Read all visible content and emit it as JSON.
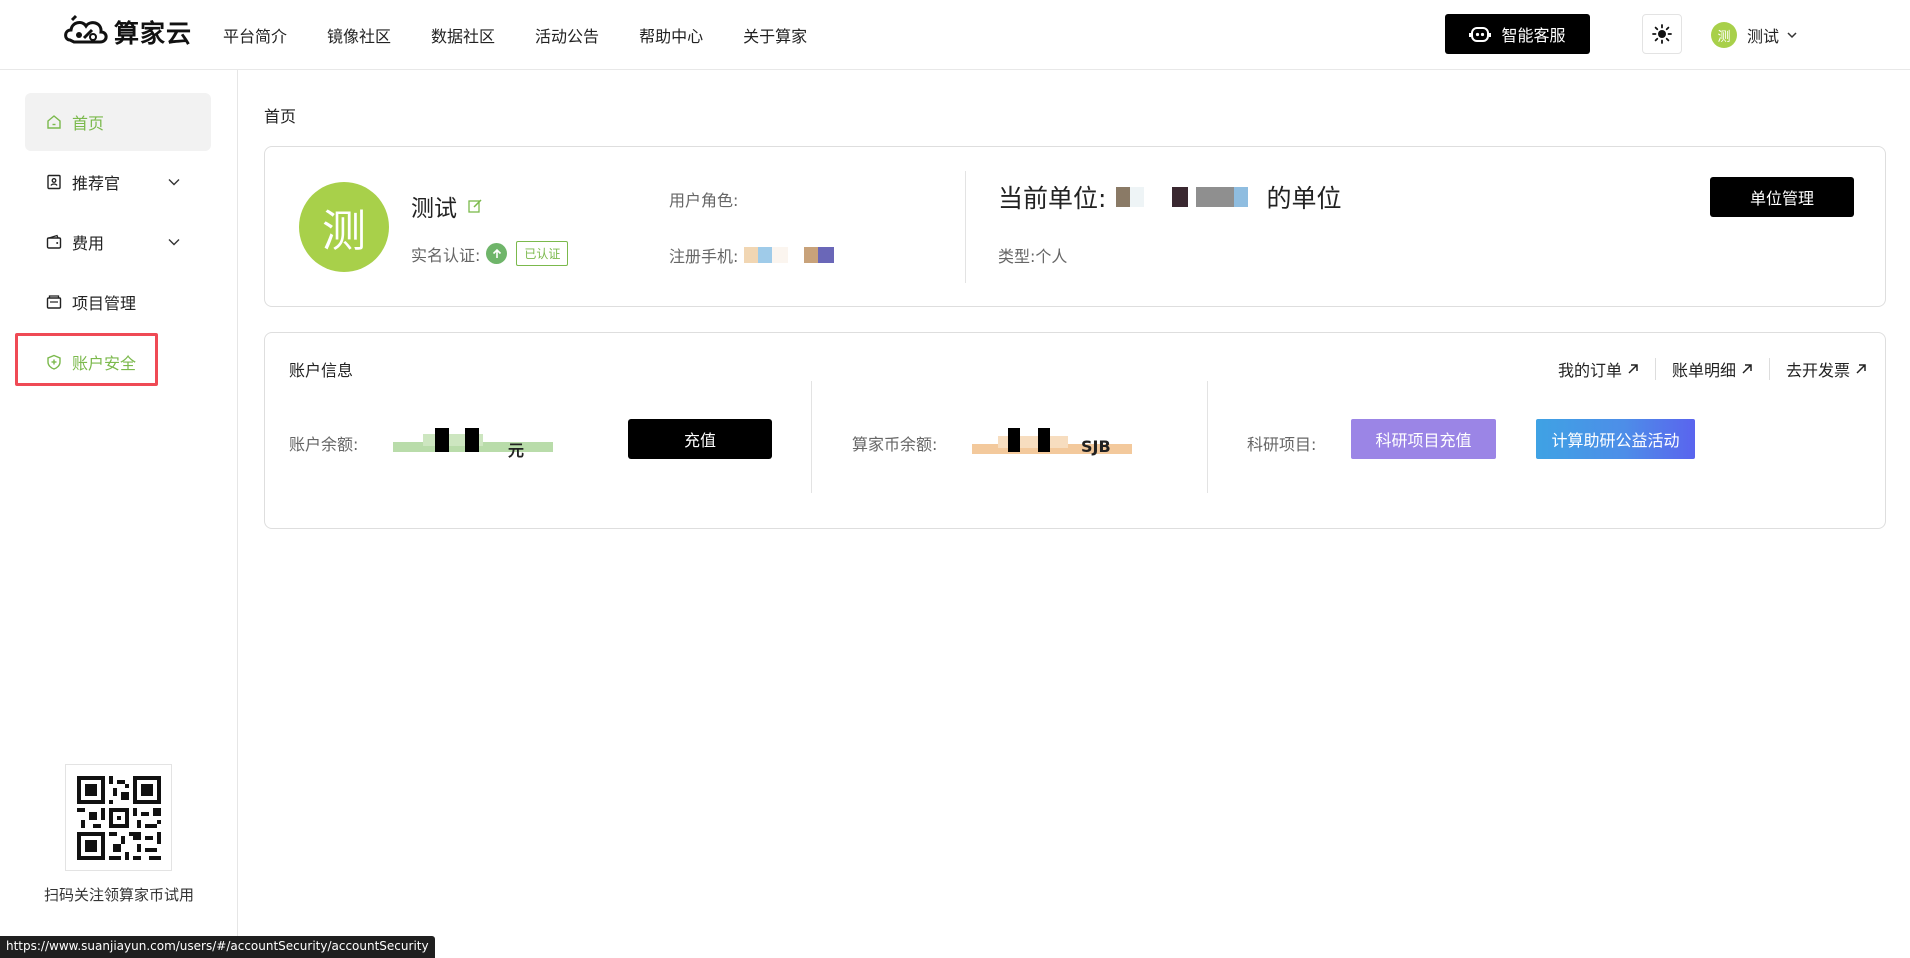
{
  "header": {
    "logo_text": "算家云",
    "nav": [
      "平台简介",
      "镜像社区",
      "数据社区",
      "活动公告",
      "帮助中心",
      "关于算家"
    ],
    "service_button": "智能客服",
    "user": {
      "avatar_char": "测",
      "name": "测试"
    }
  },
  "sidebar": {
    "items": [
      {
        "label": "首页"
      },
      {
        "label": "推荐官"
      },
      {
        "label": "费用"
      },
      {
        "label": "项目管理"
      },
      {
        "label": "账户安全"
      }
    ],
    "qr_caption": "扫码关注领算家币试用"
  },
  "breadcrumb": "首页",
  "profile": {
    "avatar_char": "测",
    "name": "测试",
    "verify_label": "实名认证:",
    "verify_badge": "已认证",
    "role_label": "用户角色:",
    "phone_label": "注册手机:",
    "unit_prefix": "当前单位:",
    "unit_suffix": "的单位",
    "type_text": "类型:个人",
    "unit_manage_button": "单位管理"
  },
  "account": {
    "title": "账户信息",
    "links": [
      "我的订单",
      "账单明细",
      "去开发票"
    ],
    "balance_label": "账户余额:",
    "balance_unit": "元",
    "recharge_button": "充值",
    "coin_label": "算家币余额:",
    "coin_unit": "SJB",
    "research_label": "科研项目:",
    "research_recharge_button": "科研项目充值",
    "activity_button": "计算助研公益活动"
  },
  "status_url": "https://www.suanjiayun.com/users/#/accountSecurity/accountSecurity",
  "colors": {
    "brand_green": "#7bb94c",
    "avatar_green": "#a8d04a",
    "highlight_red": "#ef4a55",
    "purple": "#9b85e6"
  }
}
